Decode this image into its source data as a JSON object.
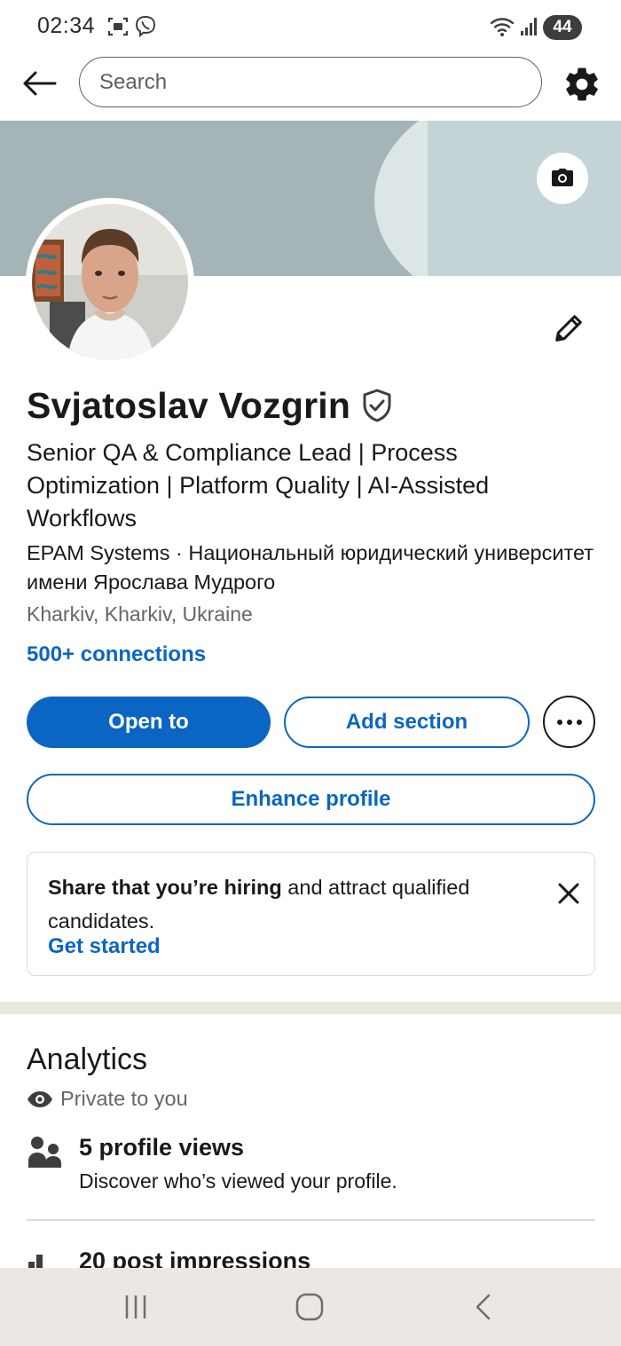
{
  "status_bar": {
    "time": "02:34",
    "battery": "44"
  },
  "search": {
    "placeholder": "Search"
  },
  "profile": {
    "name": "Svjatoslav Vozgrin",
    "headline": "Senior QA & Compliance Lead | Process Optimization | Platform Quality | AI-Assisted Workflows",
    "company": "EPAM Systems · Национальный юридический университет имени Ярослава Мудрого",
    "location": "Kharkiv, Kharkiv, Ukraine",
    "connections": "500+ connections"
  },
  "actions": {
    "open_to": "Open to",
    "add_section": "Add section",
    "enhance_profile": "Enhance profile"
  },
  "hiring_card": {
    "bold_text": "Share that you’re hiring",
    "text": " and attract qualified candidates.",
    "link": "Get started"
  },
  "analytics": {
    "title": "Analytics",
    "privacy": "Private to you",
    "items": [
      {
        "icon": "people-icon",
        "title": "5 profile views",
        "subtitle": "Discover who’s viewed your profile."
      },
      {
        "icon": "bar-chart-icon",
        "title": "20 post impressions",
        "subtitle": ""
      }
    ]
  },
  "colors": {
    "accent": "#0a66c2",
    "banner": "#a4b4b7",
    "text": "#191919",
    "muted": "#666666"
  }
}
